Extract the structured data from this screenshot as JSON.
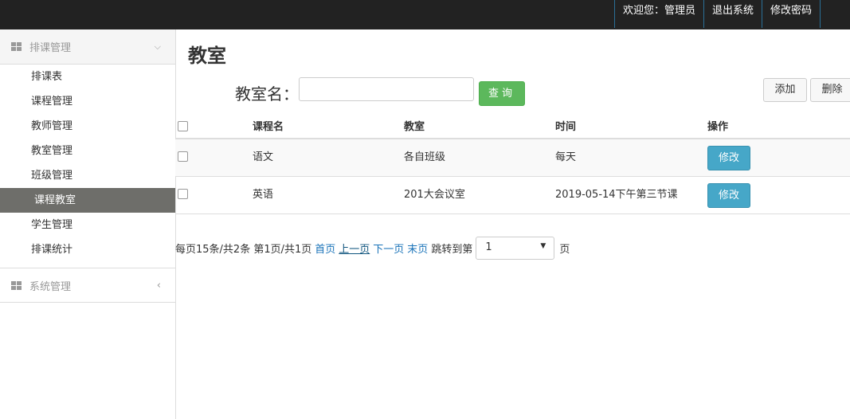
{
  "topnav": {
    "welcome": "欢迎您：管理员",
    "logout": "退出系统",
    "change_password": "修改密码"
  },
  "sidebar": {
    "group1": {
      "label": "排课管理",
      "items": [
        {
          "label": "排课表"
        },
        {
          "label": "课程管理"
        },
        {
          "label": "教师管理"
        },
        {
          "label": "教室管理"
        },
        {
          "label": "班级管理"
        },
        {
          "label": "课程教室",
          "active": true
        },
        {
          "label": "学生管理"
        },
        {
          "label": "排课统计"
        }
      ]
    },
    "group2": {
      "label": "系统管理"
    }
  },
  "main": {
    "title": "教室",
    "search_label": "教室名：",
    "search_value": "",
    "query_button": "查询",
    "add_button": "添加",
    "delete_button": "删除"
  },
  "table": {
    "headers": [
      "课程名",
      "教室",
      "时间",
      "操作"
    ],
    "rows": [
      {
        "course": "语文",
        "room": "各自班级",
        "time": "每天",
        "action": "修改"
      },
      {
        "course": "英语",
        "room": "201大会议室",
        "time": "2019-05-14下午第三节课",
        "action": "修改"
      }
    ]
  },
  "pager": {
    "summary": "每页15条/共2条 第1页/共1页",
    "first": "首页",
    "prev": "上一页",
    "next": "下一页",
    "last": "末页",
    "jump_label": "跳转到第",
    "page_value": "1",
    "page_suffix": "页"
  }
}
